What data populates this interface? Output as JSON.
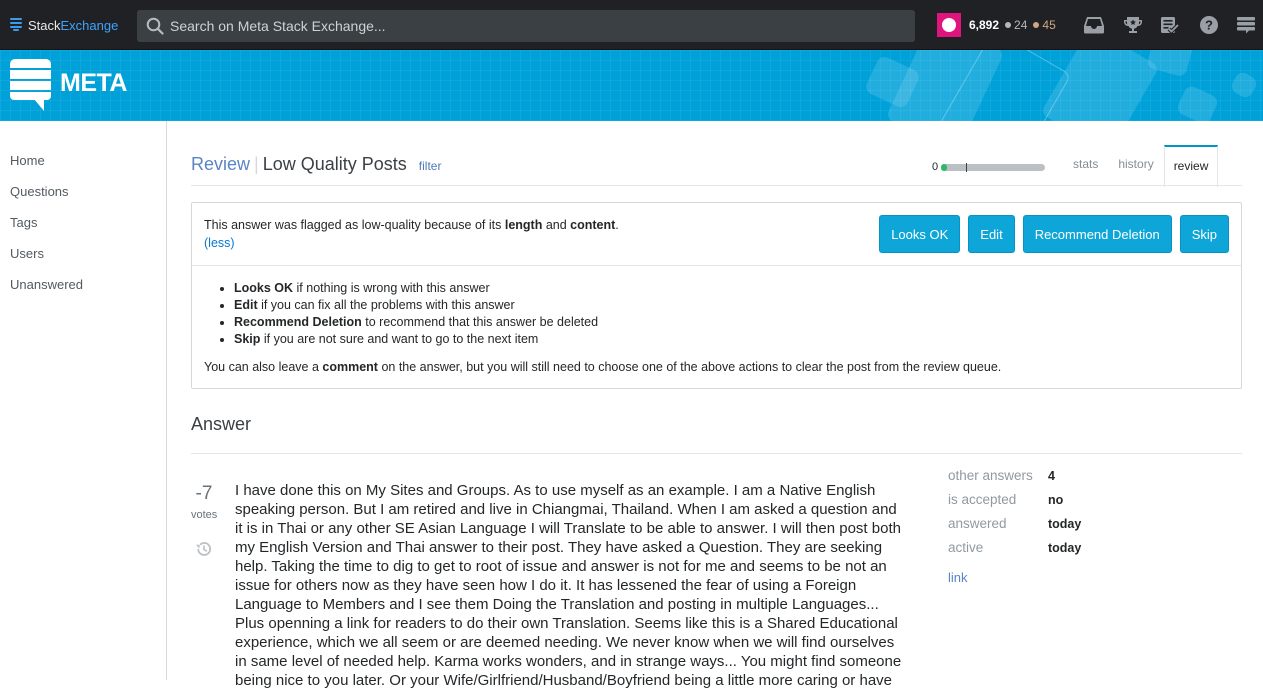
{
  "topbar": {
    "brand_part1": "Stack",
    "brand_part2": "Exchange",
    "search_placeholder": "Search on Meta Stack Exchange...",
    "reputation": "6,892",
    "silver_badges": "24",
    "bronze_badges": "45",
    "icons": [
      "inbox-icon",
      "achievements-icon",
      "review-queue-icon",
      "help-icon",
      "site-switcher-icon"
    ]
  },
  "banner": {
    "site_name": "META"
  },
  "sidebar": {
    "items": [
      {
        "label": "Home"
      },
      {
        "label": "Questions"
      },
      {
        "label": "Tags"
      },
      {
        "label": "Users"
      },
      {
        "label": "Unanswered"
      }
    ]
  },
  "header": {
    "review_link": "Review",
    "separator": "|",
    "queue_title": "Low Quality Posts",
    "filter_link": "filter",
    "progress_count": "0",
    "progress_fraction": 0.05,
    "tabs": [
      {
        "label": "stats",
        "active": false
      },
      {
        "label": "history",
        "active": false
      },
      {
        "label": "review",
        "active": true
      }
    ]
  },
  "instructions": {
    "flag_prefix": "This answer was flagged as low-quality because of its ",
    "flag_reason1": "length",
    "flag_and": " and ",
    "flag_reason2": "content",
    "flag_suffix": ".",
    "less_link": "(less)",
    "buttons": [
      {
        "label": "Looks OK"
      },
      {
        "label": "Edit"
      },
      {
        "label": "Recommend Deletion"
      },
      {
        "label": "Skip"
      }
    ],
    "guide": [
      {
        "action": "Looks OK",
        "text": " if nothing is wrong with this answer"
      },
      {
        "action": "Edit",
        "text": " if you can fix all the problems with this answer"
      },
      {
        "action": "Recommend Deletion",
        "text": " to recommend that this answer be deleted"
      },
      {
        "action": "Skip",
        "text": " if you are not sure and want to go to the next item"
      }
    ],
    "also_prefix": "You can also leave a ",
    "also_bold": "comment",
    "also_suffix": " on the answer, but you will still need to choose one of the above actions to clear the post from the review queue."
  },
  "answer": {
    "heading": "Answer",
    "vote_count": "-7",
    "vote_label": "votes",
    "body": "I have done this on My Sites and Groups. As to use myself as an example. I am a Native English speaking person. But I am retired and live in Chiangmai, Thailand. When I am asked a question and it is in Thai or any other SE Asian Language I will Translate to be able to answer. I will then post both my English Version and Thai answer to their post. They have asked a Question. They are seeking help. Taking the time to dig to get to root of issue and answer is not for me and seems to be not an issue for others now as they have seen how I do it. It has lessened the fear of using a Foreign Language to Members and I see them Doing the Translation and posting in multiple Languages... Plus openning a link for readers to do their own Translation. Seems like this is a Shared Educational experience, which we all seem or are deemed needing. We never know when we will find ourselves in same level of needed help. Karma works wonders, and in strange ways... You might find someone being nice to you later. Or your Wife/Girlfriend/Husband/Boyfriend being a little more caring or have",
    "stats": [
      {
        "label": "other answers",
        "value": "4"
      },
      {
        "label": "is accepted",
        "value": "no"
      },
      {
        "label": "answered",
        "value": "today"
      },
      {
        "label": "active",
        "value": "today"
      }
    ],
    "link_label": "link"
  }
}
